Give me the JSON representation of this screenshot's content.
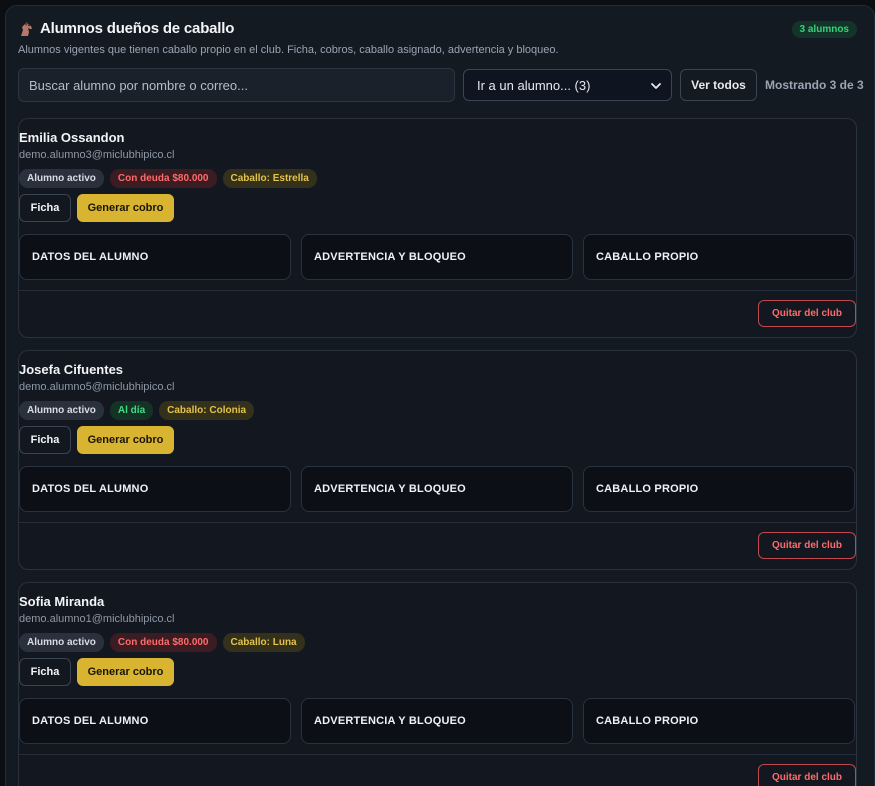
{
  "header": {
    "title": "Alumnos dueños de caballo",
    "subtitle": "Alumnos vigentes que tienen caballo propio en el club. Ficha, cobros, caballo asignado, advertencia y bloqueo.",
    "count_badge": "3 alumnos",
    "icon": "horse-icon"
  },
  "toolbar": {
    "search_placeholder": "Buscar alumno por nombre o correo...",
    "select_value": "Ir a un alumno... (3)",
    "view_all_label": "Ver todos",
    "showing_text": "Mostrando 3 de 3"
  },
  "labels": {
    "ficha": "Ficha",
    "generar_cobro": "Generar cobro",
    "datos_alumno": "DATOS DEL ALUMNO",
    "advertencia": "ADVERTENCIA Y BLOQUEO",
    "caballo_propio": "CABALLO PROPIO",
    "quitar": "Quitar del club"
  },
  "students": [
    {
      "name": "Emilia Ossandon",
      "email": "demo.alumno3@miclubhipico.cl",
      "status": "Alumno activo",
      "payment": "Con deuda $80.000",
      "payment_state": "debt",
      "horse": "Caballo: Estrella"
    },
    {
      "name": "Josefa Cifuentes",
      "email": "demo.alumno5@miclubhipico.cl",
      "status": "Alumno activo",
      "payment": "Al día",
      "payment_state": "ok",
      "horse": "Caballo: Colonia"
    },
    {
      "name": "Sofia Miranda",
      "email": "demo.alumno1@miclubhipico.cl",
      "status": "Alumno activo",
      "payment": "Con deuda $80.000",
      "payment_state": "debt",
      "horse": "Caballo: Luna"
    }
  ],
  "colors": {
    "accent_yellow": "#d9b430",
    "danger": "#ff6b6b",
    "success": "#3ddc84",
    "background": "#141a22"
  }
}
